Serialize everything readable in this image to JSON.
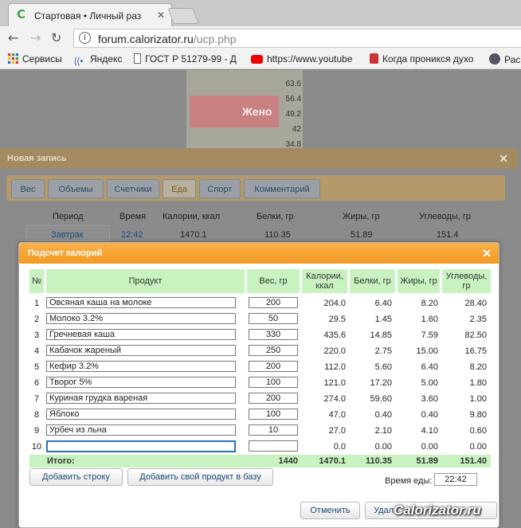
{
  "browser": {
    "tab_title": "Стартовая • Личный раз",
    "tab_favicon": "C",
    "url_host": "forum.calorizator.ru",
    "url_path": "/ucp.php",
    "bookmarks": [
      "Сервисы",
      "Яндекс",
      "ГОСТ Р 51279-99 - Д",
      "https://www.youtube",
      "Когда проникся духо",
      "Рас"
    ]
  },
  "background": {
    "axis_ticks": [
      "63.6",
      "56.4",
      "49.2",
      "42",
      "34.8"
    ],
    "image_text": "Жено"
  },
  "back_dialog": {
    "title": "Новая запись",
    "tabs": [
      "Вес",
      "Объемы",
      "Счетчики",
      "Еда",
      "Спорт",
      "Комментарий"
    ],
    "active_tab": "Еда",
    "columns": [
      "Период",
      "Время",
      "Калории, ккал",
      "Белки, гр",
      "Жиры, гр",
      "Углеводы, гр"
    ],
    "row": {
      "period": "Завтрак",
      "time": "22:42",
      "kcal": "1470.1",
      "protein": "110.35",
      "fat": "51.89",
      "carbs": "151.4"
    }
  },
  "dialog": {
    "title": "Подсчет калорий",
    "headers": [
      "№",
      "Продукт",
      "Вес, гр",
      "Калории, ккал",
      "Белки, гр",
      "Жиры, гр",
      "Углеводы, гр"
    ],
    "rows": [
      {
        "n": "1",
        "product": "Овсяная каша на молоке",
        "weight": "200",
        "kcal": "204.0",
        "protein": "6.40",
        "fat": "8.20",
        "carbs": "28.40"
      },
      {
        "n": "2",
        "product": "Молоко 3.2%",
        "weight": "50",
        "kcal": "29.5",
        "protein": "1.45",
        "fat": "1.60",
        "carbs": "2.35"
      },
      {
        "n": "3",
        "product": "Гречневая каша",
        "weight": "330",
        "kcal": "435.6",
        "protein": "14.85",
        "fat": "7.59",
        "carbs": "82.50"
      },
      {
        "n": "4",
        "product": "Кабачок жареный",
        "weight": "250",
        "kcal": "220.0",
        "protein": "2.75",
        "fat": "15.00",
        "carbs": "16.75"
      },
      {
        "n": "5",
        "product": "Кефир 3.2%",
        "weight": "200",
        "kcal": "112.0",
        "protein": "5.60",
        "fat": "6.40",
        "carbs": "8.20"
      },
      {
        "n": "6",
        "product": "Творог 5%",
        "weight": "100",
        "kcal": "121.0",
        "protein": "17.20",
        "fat": "5.00",
        "carbs": "1.80"
      },
      {
        "n": "7",
        "product": "Куриная грудка вареная",
        "weight": "200",
        "kcal": "274.0",
        "protein": "59.60",
        "fat": "3.60",
        "carbs": "1.00"
      },
      {
        "n": "8",
        "product": "Яблоко",
        "weight": "100",
        "kcal": "47.0",
        "protein": "0.40",
        "fat": "0.40",
        "carbs": "9.80"
      },
      {
        "n": "9",
        "product": "Урбеч из льна",
        "weight": "10",
        "kcal": "27.0",
        "protein": "2.10",
        "fat": "4.10",
        "carbs": "0.60"
      },
      {
        "n": "10",
        "product": "",
        "weight": "",
        "kcal": "0.0",
        "protein": "0.00",
        "fat": "0.00",
        "carbs": "0.00"
      }
    ],
    "total": {
      "label": "Итого:",
      "weight": "1440",
      "kcal": "1470.1",
      "protein": "110.35",
      "fat": "51.89",
      "carbs": "151.40"
    },
    "add_row_label": "Добавить строку",
    "add_product_label": "Добавить свой продукт в базу",
    "meal_time_label": "Время еды:",
    "meal_time_value": "22:42",
    "cancel_label": "Отменить",
    "delete_label": "Удал"
  },
  "watermark": "Calorizator.ru"
}
